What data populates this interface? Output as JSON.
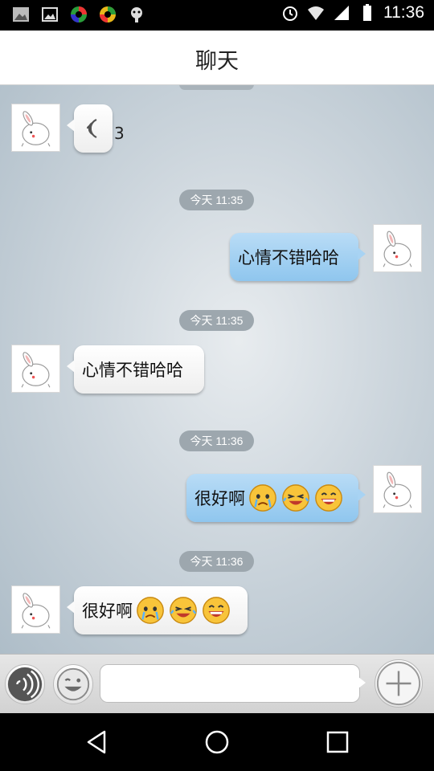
{
  "status_bar": {
    "time": "11:36"
  },
  "header": {
    "title": "聊天"
  },
  "messages": [
    {
      "type": "voice",
      "direction": "in",
      "duration": "3"
    },
    {
      "type": "time",
      "text": "今天 11:35"
    },
    {
      "type": "text",
      "direction": "out",
      "text": "心情不错哈哈"
    },
    {
      "type": "time",
      "text": "今天 11:35"
    },
    {
      "type": "text",
      "direction": "in",
      "text": "心情不错哈哈"
    },
    {
      "type": "time",
      "text": "今天 11:36"
    },
    {
      "type": "text",
      "direction": "out",
      "text": "很好啊",
      "emojis": [
        "crying-face-icon",
        "laughing-squint-icon",
        "grinning-face-icon"
      ]
    },
    {
      "type": "time",
      "text": "今天 11:36"
    },
    {
      "type": "text",
      "direction": "in",
      "text": "很好啊",
      "emojis": [
        "crying-face-icon",
        "laughing-squint-icon",
        "grinning-face-icon"
      ]
    }
  ],
  "input_bar": {
    "message_value": ""
  },
  "colors": {
    "outgoing_bubble": "#9fcff2",
    "incoming_bubble": "#ffffff",
    "timestamp_pill": "#9da7ae"
  }
}
